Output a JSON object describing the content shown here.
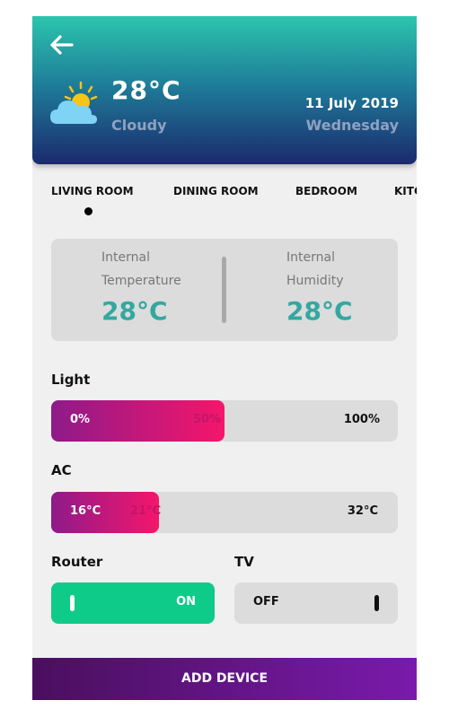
{
  "header": {
    "temperature": "28°C",
    "condition": "Cloudy",
    "date": "11 July 2019",
    "weekday": "Wednesday",
    "weather_icon": "partly-cloudy-icon",
    "back_icon": "arrow-left-icon"
  },
  "tabs": [
    {
      "label": "LIVING ROOM",
      "active": true
    },
    {
      "label": "DINING ROOM",
      "active": false
    },
    {
      "label": "BEDROOM",
      "active": false
    },
    {
      "label": "KITC",
      "active": false
    }
  ],
  "sensors": {
    "temperature": {
      "label_line1": "Internal",
      "label_line2": "Temperature",
      "value": "28°C"
    },
    "humidity": {
      "label_line1": "Internal",
      "label_line2": "Humidity",
      "value": "28°C"
    }
  },
  "light": {
    "label": "Light",
    "min_label": "0%",
    "current_label": "50%",
    "max_label": "100%",
    "level_fraction": 0.5
  },
  "ac": {
    "label": "AC",
    "min_label": "16°C",
    "current_label": "21°C",
    "max_label": "32°C",
    "level_fraction": 0.31
  },
  "router": {
    "label": "Router",
    "state": "ON"
  },
  "tv": {
    "label": "TV",
    "state": "OFF"
  },
  "add_device_label": "ADD DEVICE",
  "colors": {
    "accent_teal": "#33a8a0",
    "slider_gradient_start": "#8e1a8a",
    "slider_gradient_end": "#f5166b",
    "toggle_on": "#0fcb8a",
    "button_gradient_start": "#4a0f5e",
    "button_gradient_end": "#7a1aab"
  }
}
